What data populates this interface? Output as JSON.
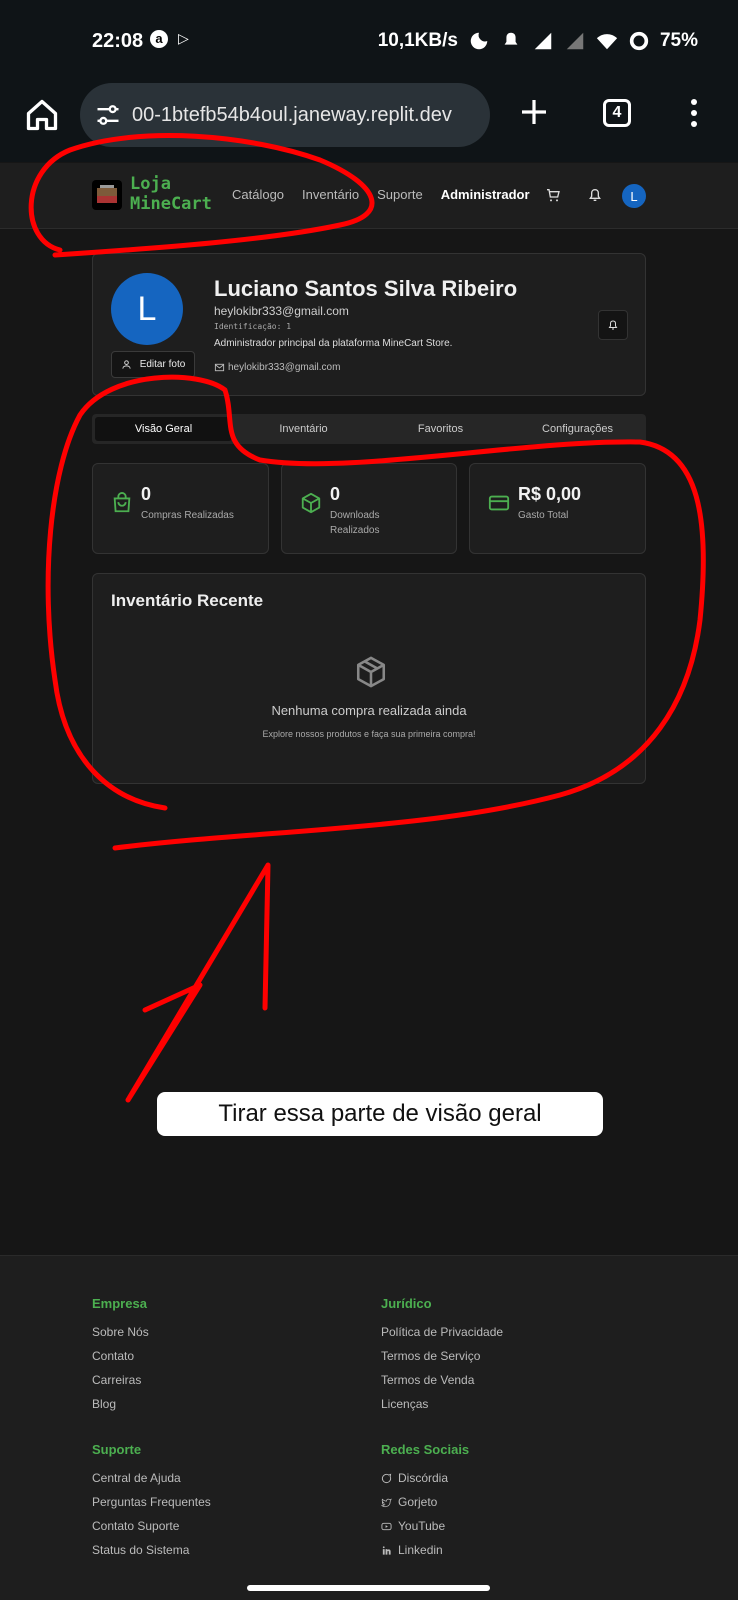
{
  "status_bar": {
    "time": "22:08",
    "speed": "10,1KB/s",
    "battery": "75%"
  },
  "browser": {
    "url": "00-1btefb54b4oul.janeway.replit.dev",
    "tab_count": "4"
  },
  "header": {
    "brand_line1": "Loja",
    "brand_line2": "MineCart",
    "nav": [
      "Catálogo",
      "Inventário",
      "Suporte",
      "Administrador"
    ],
    "avatar_letter": "L"
  },
  "profile": {
    "avatar_letter": "L",
    "name": "Luciano Santos Silva Ribeiro",
    "email": "heylokibr333@gmail.com",
    "id_label": "Identificação: 1",
    "description": "Administrador principal da plataforma MineCart Store.",
    "contact_email": "heylokibr333@gmail.com",
    "edit_photo_label": "Editar foto"
  },
  "tabs": [
    "Visão Geral",
    "Inventário",
    "Favoritos",
    "Configurações"
  ],
  "stats": [
    {
      "value": "0",
      "label": "Compras Realizadas",
      "icon": "shopping-bag-icon"
    },
    {
      "value": "0",
      "label": "Downloads Realizados",
      "icon": "package-icon"
    },
    {
      "value": "R$ 0,00",
      "label": "Gasto Total",
      "icon": "credit-card-icon"
    }
  ],
  "recent_inventory": {
    "title": "Inventário Recente",
    "empty_title": "Nenhuma compra realizada ainda",
    "empty_subtitle": "Explore nossos produtos e faça sua primeira compra!"
  },
  "annotation": {
    "text": "Tirar essa parte de visão geral",
    "color": "#ff0000"
  },
  "footer": {
    "empresa": {
      "heading": "Empresa",
      "links": [
        "Sobre Nós",
        "Contato",
        "Carreiras",
        "Blog"
      ]
    },
    "juridico": {
      "heading": "Jurídico",
      "links": [
        "Política de Privacidade",
        "Termos de Serviço",
        "Termos de Venda",
        "Licenças"
      ]
    },
    "suporte": {
      "heading": "Suporte",
      "links": [
        "Central de Ajuda",
        "Perguntas Frequentes",
        "Contato Suporte",
        "Status do Sistema"
      ]
    },
    "redes": {
      "heading": "Redes Sociais",
      "links": [
        "Discórdia",
        "Gorjeto",
        "YouTube",
        "Linkedin"
      ]
    }
  },
  "colors": {
    "accent_green": "#4caf50",
    "avatar_blue": "#1565c0",
    "background": "#161616",
    "card": "#1e1e1e"
  }
}
